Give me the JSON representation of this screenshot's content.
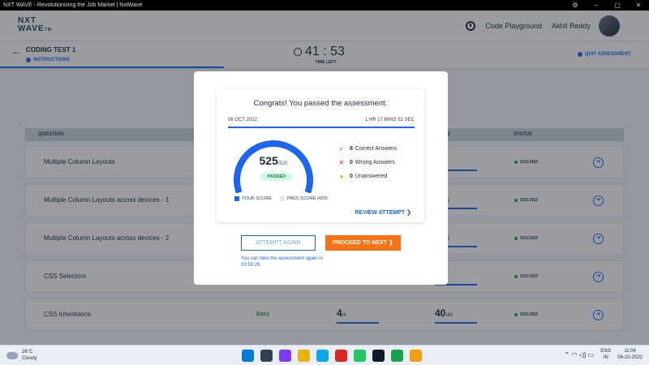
{
  "window": {
    "title": "NXT WAVE - Revolutionizing the Job Market | NxtWave",
    "controls": [
      "⚙",
      "–",
      "▢",
      "✕"
    ]
  },
  "header": {
    "logo_line1": "NXT",
    "logo_line2": "WAVE",
    "logo_tm": "TM",
    "playground": "Code Playground",
    "user": "Akhil Reddy"
  },
  "testbar": {
    "back_icon": "←",
    "title": "CODING TEST 1",
    "instructions": "INSTRUCTIONS",
    "time": "41 : 53",
    "time_label": "TIME LEFT",
    "quit": "QUIT ASSESSMENT"
  },
  "table": {
    "col_question": "QUESTION",
    "col_score": "E",
    "col_status": "STATUS",
    "rows": [
      {
        "q": "Multiple Column Layouts",
        "diff": "",
        "s1": "",
        "s1d": "",
        "s2": "",
        "s2d": "/40",
        "status": "SOLVED"
      },
      {
        "q": "Multiple Column Layouts across devices - 1",
        "diff": "",
        "s1": "",
        "s1d": "",
        "s2": "5",
        "s2d": "/115",
        "status": "SOLVED"
      },
      {
        "q": "Multiple Column Layouts across devices - 2",
        "diff": "",
        "s1": "",
        "s1d": "",
        "s2": "0",
        "s2d": "/120",
        "status": "SOLVED"
      },
      {
        "q": "CSS Selectors",
        "diff": "",
        "s1": "",
        "s1d": "",
        "s2": "",
        "s2d": "/40",
        "status": "SOLVED"
      },
      {
        "q": "CSS Inheritance",
        "diff": "Easy",
        "s1": "4",
        "s1d": "/4",
        "s2": "40",
        "s2d": "/40",
        "status": "SOLVED"
      }
    ]
  },
  "modal": {
    "congrats": "Congrats! You passed the assessment.",
    "date": "06 OCT 2022",
    "duration": "1 HR 17 MINS 52 SEC",
    "score": "525",
    "score_total": "/525",
    "passed": "PASSED",
    "legend_your": "YOUR SCORE",
    "legend_pass": "PASS SCORE (420)",
    "correct_count": "8",
    "correct_label": "Correct Answers",
    "wrong_count": "0",
    "wrong_label": "Wrong Answers",
    "unanswered_count": "0",
    "unanswered_label": "Unanswered",
    "review": "REVIEW ATTEMPT ❯",
    "attempt_again": "ATTEMPT AGAIN",
    "proceed": "PROCEED TO NEXT ❯",
    "retake_note": "You can take the assessment again in 03:59:29"
  },
  "gauge": {
    "score_fraction": 1.0,
    "pass_fraction": 0.8,
    "score_color": "#1c64f2",
    "track_color": "#dbeafe"
  },
  "colors": {
    "accent": "#1c64f2",
    "orange": "#f97316",
    "green": "#16a34a"
  },
  "taskbar": {
    "temp": "26°C",
    "weather": "Cloudy",
    "lang1": "ENG",
    "lang2": "IN",
    "time": "11:04",
    "date": "06-10-2022",
    "tray_icons": "⌃ ◠ ◁) ▭"
  }
}
